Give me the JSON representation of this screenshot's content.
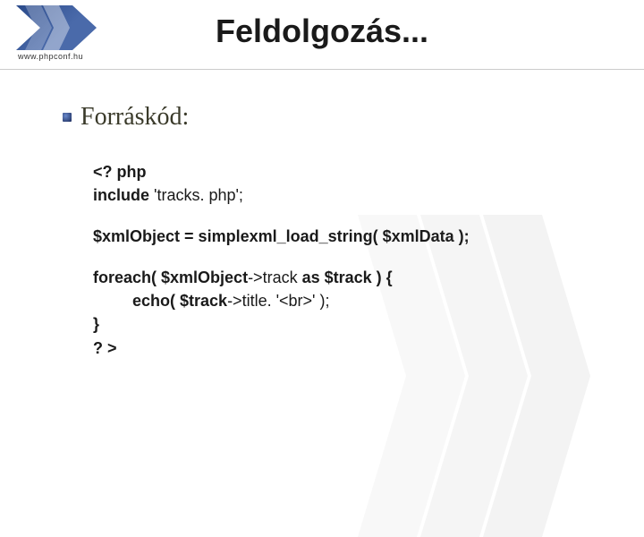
{
  "header": {
    "site_url": "www.phpconf.hu",
    "logo_name": "chevron-logo"
  },
  "title": "Feldolgozás...",
  "section": {
    "heading": "Forráskód:"
  },
  "code": {
    "l1a": "<? php",
    "l2a": "include",
    "l2b": " 'tracks. php';",
    "l3": "$xmlObject = simplexml_load_string( $xmlData );",
    "l4a": "foreach( $xmlObject",
    "l4b": "->track ",
    "l4c": "as $track ) {",
    "l5a": "echo( $track",
    "l5b": "->title. '<br>' );",
    "l6": "}",
    "l7": "? >"
  }
}
